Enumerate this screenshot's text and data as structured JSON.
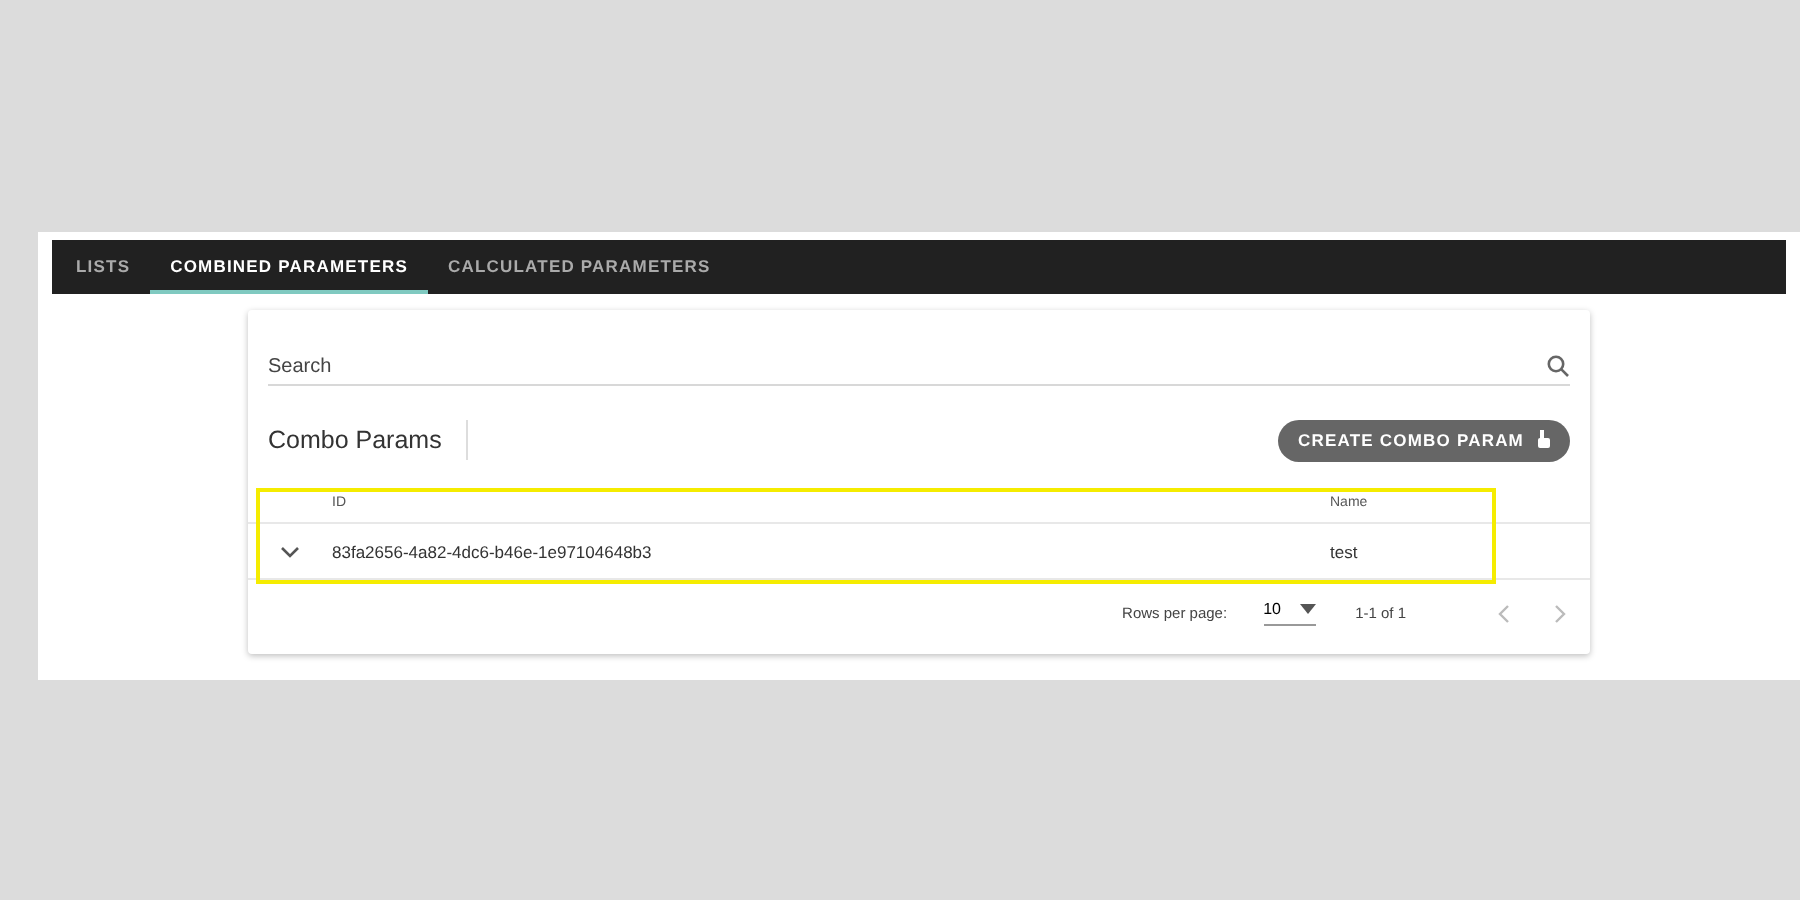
{
  "tabs": [
    {
      "label": "LISTS",
      "selected": false
    },
    {
      "label": "COMBINED PARAMETERS",
      "selected": true
    },
    {
      "label": "CALCULATED PARAMETERS",
      "selected": false
    }
  ],
  "search": {
    "placeholder": "Search"
  },
  "section_title": "Combo Params",
  "create_button": "CREATE COMBO PARAM",
  "table": {
    "columns": [
      "ID",
      "Name"
    ],
    "rows": [
      {
        "id": "83fa2656-4a82-4dc6-b46e-1e97104648b3",
        "name": "test",
        "expanded": false
      }
    ]
  },
  "pagination": {
    "rows_per_page_label": "Rows per page:",
    "rows_per_page": "10",
    "range": "1-1 of 1"
  }
}
